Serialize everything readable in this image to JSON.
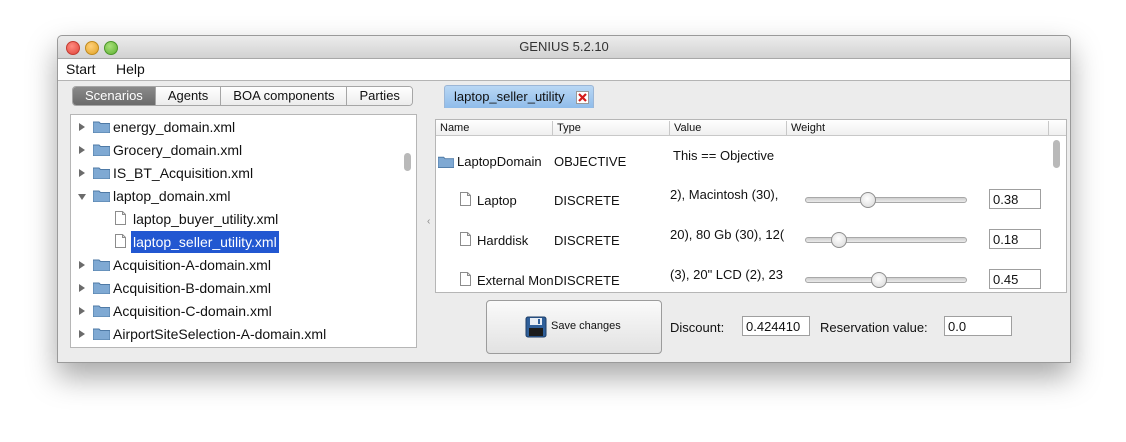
{
  "window": {
    "title": "GENIUS 5.2.10"
  },
  "menu": {
    "items": [
      "Start",
      "Help"
    ]
  },
  "left_tabs": [
    "Scenarios",
    "Agents",
    "BOA components",
    "Parties"
  ],
  "tree": {
    "items": [
      {
        "label": "energy_domain.xml",
        "kind": "folder",
        "expanded": false
      },
      {
        "label": "Grocery_domain.xml",
        "kind": "folder",
        "expanded": false
      },
      {
        "label": "IS_BT_Acquisition.xml",
        "kind": "folder",
        "expanded": false
      },
      {
        "label": "laptop_domain.xml",
        "kind": "folder",
        "expanded": true
      },
      {
        "label": "laptop_buyer_utility.xml",
        "kind": "file",
        "selected": false
      },
      {
        "label": "laptop_seller_utility.xml",
        "kind": "file",
        "selected": true
      },
      {
        "label": "Acquisition-A-domain.xml",
        "kind": "folder",
        "expanded": false
      },
      {
        "label": "Acquisition-B-domain.xml",
        "kind": "folder",
        "expanded": false
      },
      {
        "label": "Acquisition-C-domain.xml",
        "kind": "folder",
        "expanded": false
      },
      {
        "label": "AirportSiteSelection-A-domain.xml",
        "kind": "folder",
        "expanded": false
      }
    ]
  },
  "editor": {
    "tab_label": "laptop_seller_utility",
    "columns": [
      "Name",
      "Type",
      "Value",
      "Weight"
    ],
    "root": {
      "name": "LaptopDomain",
      "type": "OBJECTIVE",
      "value": "This == Objective"
    },
    "issues": [
      {
        "name": "Laptop",
        "type": "DISCRETE",
        "value": "2), Macintosh (30),",
        "weight": "0.38",
        "weight_fraction": 0.38
      },
      {
        "name": "Harddisk",
        "type": "DISCRETE",
        "value": "20), 80 Gb (30), 12(",
        "weight": "0.18",
        "weight_fraction": 0.18
      },
      {
        "name": "External Moni",
        "type": "DISCRETE",
        "value": "(3), 20\" LCD (2), 23",
        "weight": "0.45",
        "weight_fraction": 0.45
      }
    ]
  },
  "footer": {
    "save_label": "Save changes",
    "discount_label": "Discount:",
    "discount_value": "0.424410",
    "reservation_label": "Reservation value:",
    "reservation_value": "0.0"
  },
  "colors": {
    "selection": "#2257d1",
    "active_tab": "#7a7a7a",
    "file_tab": "#a9cdf1"
  },
  "icons": {
    "folder": "folder-icon",
    "file": "file-icon",
    "save": "floppy-disk-icon",
    "close_tab": "close-tab-icon"
  }
}
